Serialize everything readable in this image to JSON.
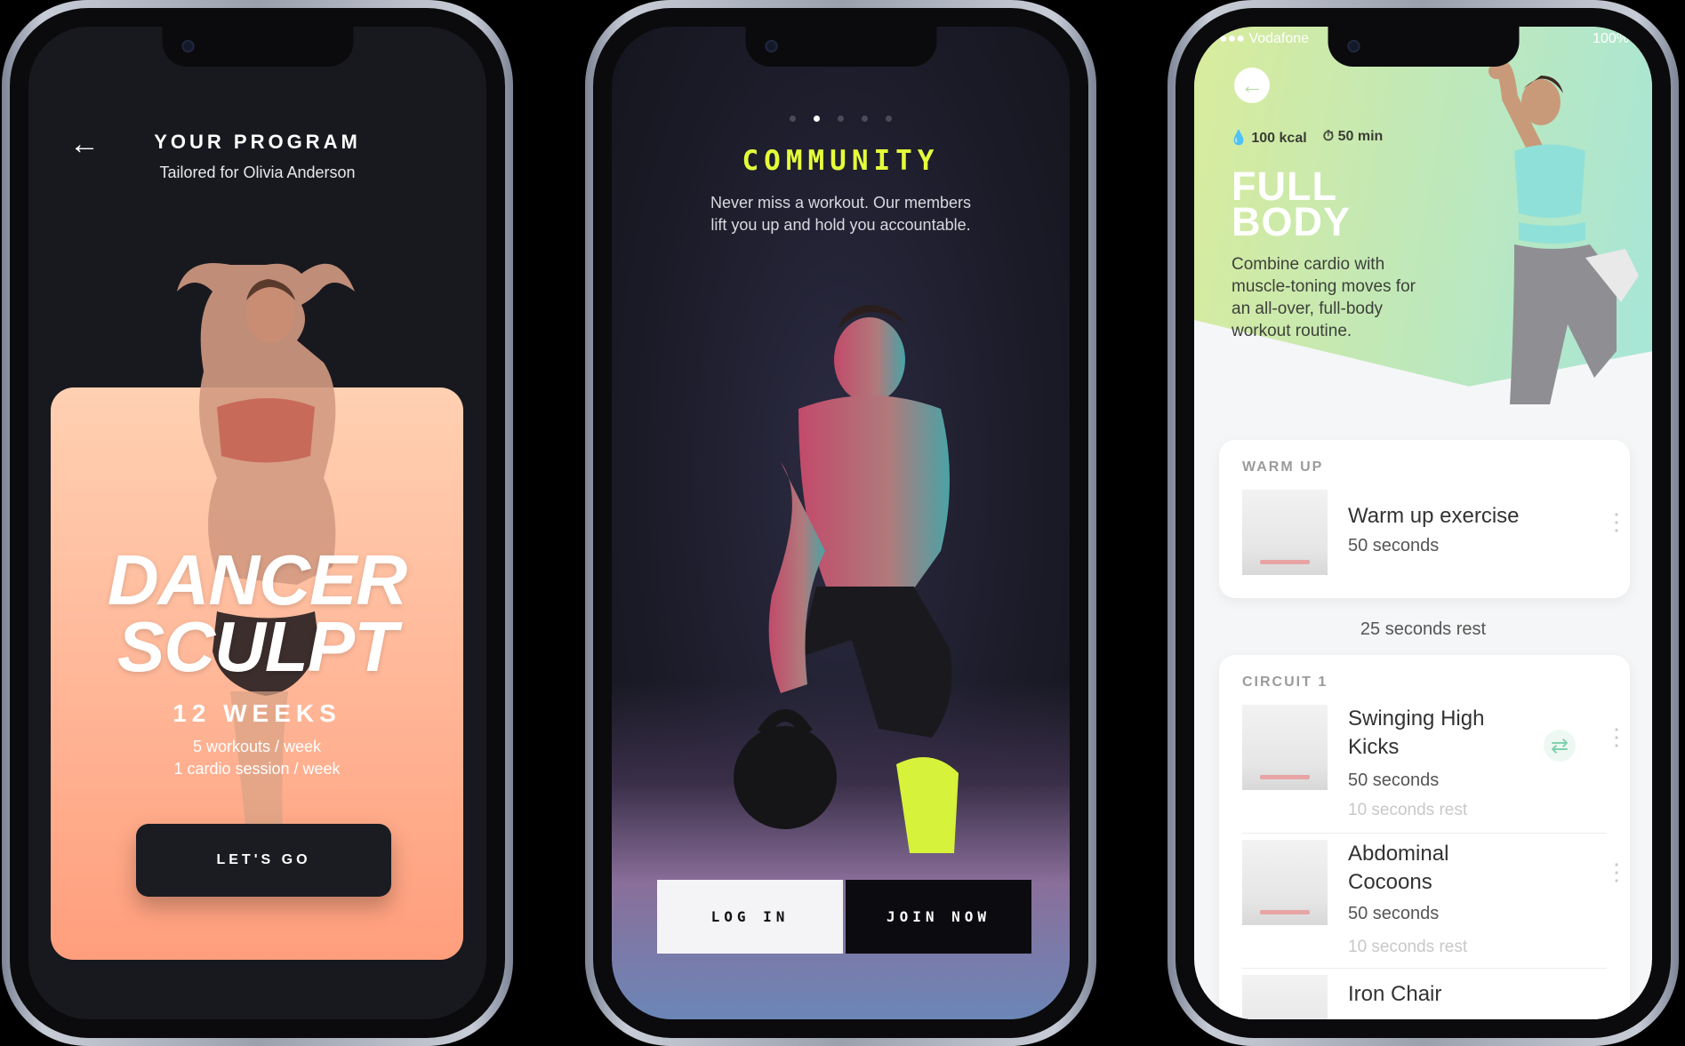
{
  "phone1": {
    "title": "YOUR PROGRAM",
    "subtitle": "Tailored for Olivia Anderson",
    "program_line1": "DANCER",
    "program_line2": "SCULPT",
    "duration": "12 WEEKS",
    "frequency1": "5 workouts / week",
    "frequency2": "1 cardio session / week",
    "cta": "LET'S GO"
  },
  "phone2": {
    "title": "COMMUNITY",
    "text_line1": "Never miss a workout. Our members",
    "text_line2": "lift you up and hold you accountable.",
    "login": "LOG IN",
    "join": "JOIN NOW",
    "page_indicator": {
      "total": 5,
      "active": 2
    }
  },
  "phone3": {
    "carrier": "Vodafone",
    "battery": "100%",
    "kcal": "100 kcal",
    "minutes": "50 min",
    "title_line1": "FULL",
    "title_line2": "BODY",
    "description": "Combine cardio with muscle-toning moves for an all-over, full-body workout routine.",
    "warmup_label": "WARM UP",
    "warmup_name": "Warm up exercise",
    "warmup_duration": "50 seconds",
    "rest_between": "25 seconds rest",
    "circuit_label": "CIRCUIT 1",
    "ex1_line1": "Swinging High",
    "ex1_line2": "Kicks",
    "ex1_duration": "50 seconds",
    "ex1_rest": "10 seconds rest",
    "ex2_line1": "Abdominal",
    "ex2_line2": "Cocoons",
    "ex2_duration": "50 seconds",
    "ex2_rest": "10 seconds rest",
    "ex3_line1": "Iron Chair"
  },
  "colors": {
    "accent_yellow": "#e5ff3a",
    "card_peach": "#ffb596",
    "dark": "#18191e",
    "mint": "#a6e6d8"
  }
}
